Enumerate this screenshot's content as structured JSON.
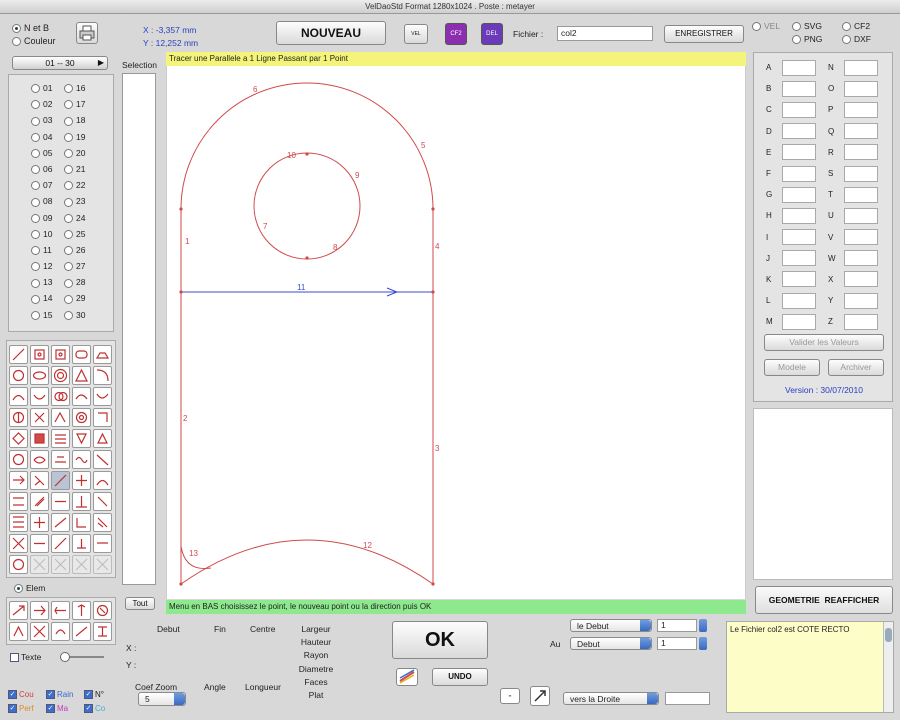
{
  "window_title": "VelDaoStd Format 1280x1024 . Poste : metayer",
  "color_mode": {
    "options": [
      "N et B",
      "Couleur"
    ],
    "selected": 0
  },
  "coords": {
    "x": "X : -3,357 mm",
    "y": "Y : 12,252 mm"
  },
  "toolbar": {
    "new_label": "NOUVEAU",
    "icons": [
      "VEL",
      "CF2",
      "DEL"
    ],
    "file_label": "Fichier :",
    "file_value": "col2",
    "save_label": "ENREGISTRER"
  },
  "formats": {
    "items": [
      "VEL",
      "SVG",
      "CF2",
      "PNG",
      "DXF"
    ],
    "selected": "VEL"
  },
  "range_label": "01 -- 30",
  "points": [
    "01",
    "02",
    "03",
    "04",
    "05",
    "06",
    "07",
    "08",
    "09",
    "10",
    "11",
    "12",
    "13",
    "14",
    "15",
    "16",
    "17",
    "18",
    "19",
    "20",
    "21",
    "22",
    "23",
    "24",
    "25",
    "26",
    "27",
    "28",
    "29",
    "30"
  ],
  "selection_label": "Selection",
  "tout_label": "Tout",
  "top_message": "Tracer une Parallele a 1 Ligne Passant par 1 Point",
  "bottom_message": "Menu en BAS choisissez le point, le nouveau point ou la direction puis OK",
  "elem_label": "Elem",
  "texte_label": "Texte",
  "checkboxes": [
    {
      "label": "Cou",
      "color": "#d23c3c",
      "checked": true
    },
    {
      "label": "Rain",
      "color": "#3c6ad2",
      "checked": true
    },
    {
      "label": "N°",
      "color": "#222222",
      "checked": true
    },
    {
      "label": "Perf",
      "color": "#e08a2a",
      "checked": true
    },
    {
      "label": "Ma",
      "color": "#c03cc0",
      "checked": true
    },
    {
      "label": "Co",
      "color": "#3cb0d2",
      "checked": true
    }
  ],
  "drawing": {
    "labels": [
      "1",
      "2",
      "3",
      "4",
      "5",
      "6",
      "7",
      "8",
      "9",
      "10",
      "11",
      "12",
      "13"
    ],
    "outline_color": "#d04a4a",
    "line_color": "#3c4ad0"
  },
  "bottom": {
    "headers": [
      "Debut",
      "Fin",
      "Centre"
    ],
    "x_label": "X :",
    "y_label": "Y :",
    "measures": [
      "Largeur",
      "Hauteur",
      "Rayon",
      "Diametre",
      "Faces",
      "Plat"
    ],
    "coef_zoom_label": "Coef Zoom",
    "coef_zoom_value": "5",
    "angle_label": "Angle",
    "longueur_label": "Longueur",
    "ok_label": "OK",
    "undo_label": "UNDO",
    "au_label": "Au",
    "sel1": "le Debut",
    "sel2": "Debut",
    "num1": "1",
    "num2": "1",
    "direction": "vers la Droite"
  },
  "right": {
    "letters_left": [
      "A",
      "B",
      "C",
      "D",
      "E",
      "F",
      "G",
      "H",
      "I",
      "J",
      "K",
      "L",
      "M"
    ],
    "letters_right": [
      "N",
      "O",
      "P",
      "Q",
      "R",
      "S",
      "T",
      "U",
      "V",
      "W",
      "X",
      "Y",
      "Z"
    ],
    "validate_label": "Valider les Valeurs",
    "modele_label": "Modele",
    "archiver_label": "Archiver",
    "version": "Version : 30/07/2010",
    "geometrie_label": "GEOMETRIE",
    "reafficher_label": "REAFFICHER",
    "log_text": "Le Fichier col2 est COTE RECTO"
  }
}
